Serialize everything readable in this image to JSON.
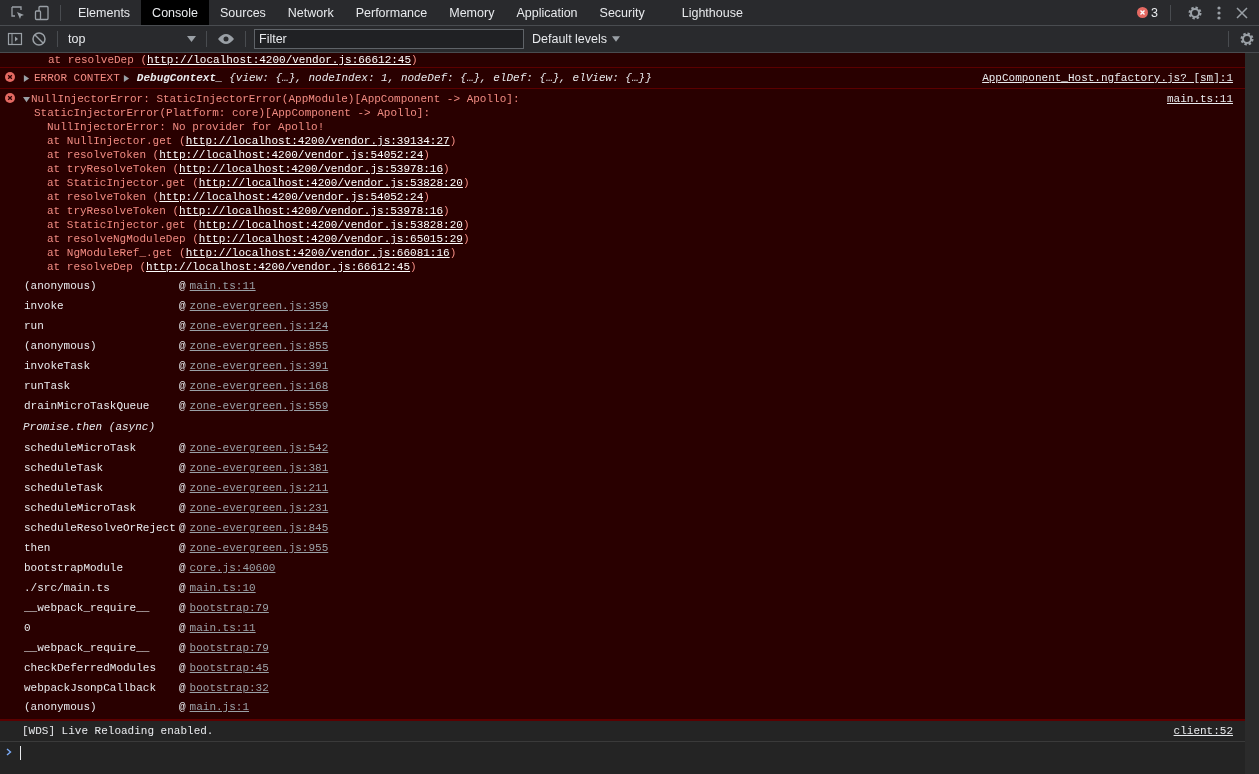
{
  "tabs": [
    {
      "label": "Elements",
      "selected": false
    },
    {
      "label": "Console",
      "selected": true
    },
    {
      "label": "Sources",
      "selected": false
    },
    {
      "label": "Network",
      "selected": false
    },
    {
      "label": "Performance",
      "selected": false
    },
    {
      "label": "Memory",
      "selected": false
    },
    {
      "label": "Application",
      "selected": false
    },
    {
      "label": "Security",
      "selected": false
    },
    {
      "label": "Lighthouse",
      "selected": false
    }
  ],
  "error_count": "3",
  "toolbar": {
    "context": "top",
    "filter_placeholder": "Filter",
    "levels": "Default levels"
  },
  "messages": [
    {
      "kind": "trace_tail",
      "text": "at resolveDep (",
      "url": "http://localhost:4200/vendor.js:66612:45",
      "end": ")"
    },
    {
      "kind": "error_context",
      "label": "ERROR CONTEXT",
      "expanded": false,
      "object_name": "DebugContext_",
      "object_body": "{view: {…}, nodeIndex: *1*, nodeDef: {…}, elDef: {…}, elView: {…}}",
      "source": "AppComponent_Host.ngfactory.js? [sm]:1"
    },
    {
      "kind": "error",
      "expanded": true,
      "source": "main.ts:11",
      "lines": [
        "NullInjectorError: StaticInjectorError(AppModule)[AppComponent -> Apollo]:",
        "StaticInjectorError(Platform: core)[AppComponent -> Apollo]:",
        "NullInjectorError: No provider for Apollo!"
      ],
      "trace": [
        {
          "text": "at NullInjector.get (",
          "url": "http://localhost:4200/vendor.js:39134:27",
          "end": ")"
        },
        {
          "text": "at resolveToken (",
          "url": "http://localhost:4200/vendor.js:54052:24",
          "end": ")"
        },
        {
          "text": "at tryResolveToken (",
          "url": "http://localhost:4200/vendor.js:53978:16",
          "end": ")"
        },
        {
          "text": "at StaticInjector.get (",
          "url": "http://localhost:4200/vendor.js:53828:20",
          "end": ")"
        },
        {
          "text": "at resolveToken (",
          "url": "http://localhost:4200/vendor.js:54052:24",
          "end": ")"
        },
        {
          "text": "at tryResolveToken (",
          "url": "http://localhost:4200/vendor.js:53978:16",
          "end": ")"
        },
        {
          "text": "at StaticInjector.get (",
          "url": "http://localhost:4200/vendor.js:53828:20",
          "end": ")"
        },
        {
          "text": "at resolveNgModuleDep (",
          "url": "http://localhost:4200/vendor.js:65015:29",
          "end": ")"
        },
        {
          "text": "at NgModuleRef_.get (",
          "url": "http://localhost:4200/vendor.js:66081:16",
          "end": ")"
        },
        {
          "text": "at resolveDep (",
          "url": "http://localhost:4200/vendor.js:66612:45",
          "end": ")"
        }
      ],
      "frames": [
        {
          "kind": "frame",
          "function": "(anonymous)",
          "at": "@",
          "location": "main.ts:11"
        },
        {
          "kind": "frame",
          "function": "invoke",
          "at": "@",
          "location": "zone-evergreen.js:359"
        },
        {
          "kind": "frame",
          "function": "run",
          "at": "@",
          "location": "zone-evergreen.js:124"
        },
        {
          "kind": "frame",
          "function": "(anonymous)",
          "at": "@",
          "location": "zone-evergreen.js:855"
        },
        {
          "kind": "frame",
          "function": "invokeTask",
          "at": "@",
          "location": "zone-evergreen.js:391"
        },
        {
          "kind": "frame",
          "function": "runTask",
          "at": "@",
          "location": "zone-evergreen.js:168"
        },
        {
          "kind": "frame",
          "function": "drainMicroTaskQueue",
          "at": "@",
          "location": "zone-evergreen.js:559"
        },
        {
          "kind": "async",
          "function": "Promise.then (async)"
        },
        {
          "kind": "frame",
          "function": "scheduleMicroTask",
          "at": "@",
          "location": "zone-evergreen.js:542"
        },
        {
          "kind": "frame",
          "function": "scheduleTask",
          "at": "@",
          "location": "zone-evergreen.js:381"
        },
        {
          "kind": "frame",
          "function": "scheduleTask",
          "at": "@",
          "location": "zone-evergreen.js:211"
        },
        {
          "kind": "frame",
          "function": "scheduleMicroTask",
          "at": "@",
          "location": "zone-evergreen.js:231"
        },
        {
          "kind": "frame",
          "function": "scheduleResolveOrReject",
          "at": "@",
          "location": "zone-evergreen.js:845"
        },
        {
          "kind": "frame",
          "function": "then",
          "at": "@",
          "location": "zone-evergreen.js:955"
        },
        {
          "kind": "frame",
          "function": "bootstrapModule",
          "at": "@",
          "location": "core.js:40600"
        },
        {
          "kind": "frame",
          "function": "./src/main.ts",
          "at": "@",
          "location": "main.ts:10"
        },
        {
          "kind": "frame",
          "function": "__webpack_require__",
          "at": "@",
          "location": "bootstrap:79"
        },
        {
          "kind": "frame",
          "function": "0",
          "at": "@",
          "location": "main.ts:11"
        },
        {
          "kind": "frame",
          "function": "__webpack_require__",
          "at": "@",
          "location": "bootstrap:79"
        },
        {
          "kind": "frame",
          "function": "checkDeferredModules",
          "at": "@",
          "location": "bootstrap:45"
        },
        {
          "kind": "frame",
          "function": "webpackJsonpCallback",
          "at": "@",
          "location": "bootstrap:32"
        },
        {
          "kind": "frame",
          "function": "(anonymous)",
          "at": "@",
          "location": "main.js:1"
        }
      ]
    },
    {
      "kind": "info",
      "text": "[WDS] Live Reloading enabled.",
      "source": "client:52"
    }
  ]
}
